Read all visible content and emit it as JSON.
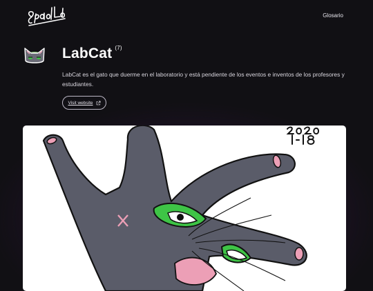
{
  "header": {
    "logo_text": "SpaceLab",
    "nav": [
      {
        "label": "Glosario"
      }
    ]
  },
  "hero": {
    "title": "LabCat",
    "count": "(7)",
    "description": "LabCat es el gato que duerme en el laboratorio y está pendiente de los eventos e inventos de los profesores y estudiantes.",
    "button_label": "Visit website"
  },
  "image": {
    "handwritten_date": "2020 1-18",
    "alt": "Drawing of LabCat"
  },
  "colors": {
    "background": "#111014",
    "accent_glow": "#3a1a48",
    "cat_body": "#5a5c69",
    "cat_eye": "#3ec446",
    "cat_pink": "#ec9fb6"
  }
}
